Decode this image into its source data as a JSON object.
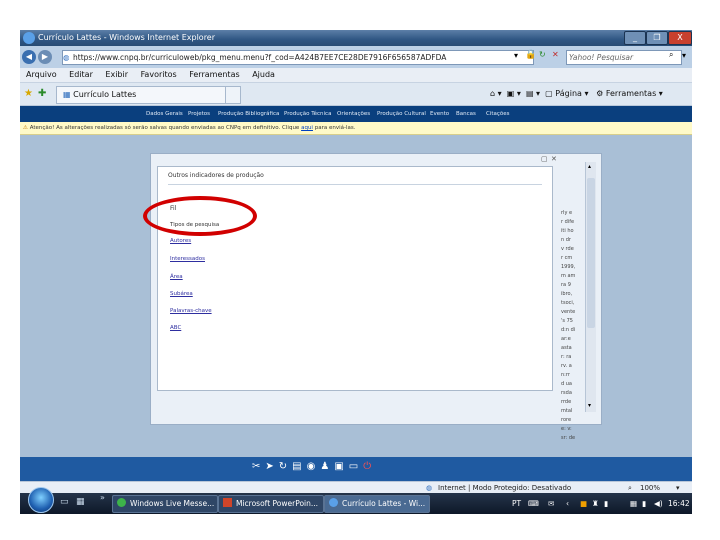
{
  "window": {
    "title": "Currículo Lattes - Windows Internet Explorer",
    "minimize": "_",
    "maximize": "❐",
    "close": "X"
  },
  "address_bar": {
    "url": "https://www.cnpq.br/curriculoweb/pkg_menu.menu?f_cod=A424B7EE7CE28DE7916F656587ADFDA",
    "search_placeholder": "Yahoo! Pesquisar"
  },
  "menu": [
    "Arquivo",
    "Editar",
    "Exibir",
    "Favoritos",
    "Ferramentas",
    "Ajuda"
  ],
  "tab": {
    "label": "Currículo Lattes"
  },
  "command_bar": {
    "page": "Página",
    "tools": "Ferramentas"
  },
  "site_nav": [
    "Dados Gerais",
    "Projetos",
    "Produção Bibliográfica",
    "Produção Técnica",
    "Orientações",
    "Produção Cultural",
    "Evento",
    "Bancas",
    "Citações"
  ],
  "info_bar": {
    "text": "Atenção! As alterações realizadas só serão salvas quando enviadas ao CNPq em definitivo. Clique",
    "link": "aqui",
    "suffix": "para enviá-las."
  },
  "dialog": {
    "heading": "Outros indicadores de produção",
    "items": [
      "Tipos de pesquisa",
      "Autores",
      "Interessados",
      "Área",
      "Subárea",
      "Palavras-chave",
      "ABC"
    ]
  },
  "side_fragments": [
    "rly e",
    "r dife",
    "iti ho",
    "n dr",
    "v rde",
    "r cm",
    "1999,",
    "m am",
    "ra 9",
    "ibro,",
    "tsoci,",
    "vente",
    "'s 75",
    "d:n di",
    "ar:e",
    "asta",
    "r: ra",
    "rv. a",
    "n:rr",
    "d ua",
    "rsda",
    "rrde",
    "mtal",
    "rore",
    "e: v:",
    "sr: de"
  ],
  "status_bar": {
    "zone": "Internet | Modo Protegido: Desativado",
    "zoom": "100%"
  },
  "taskbar": {
    "tasks": [
      "Windows Live Messe...",
      "Microsoft PowerPoin...",
      "Currículo Lattes - Wi..."
    ],
    "lang": "PT",
    "clock": "16:42"
  }
}
